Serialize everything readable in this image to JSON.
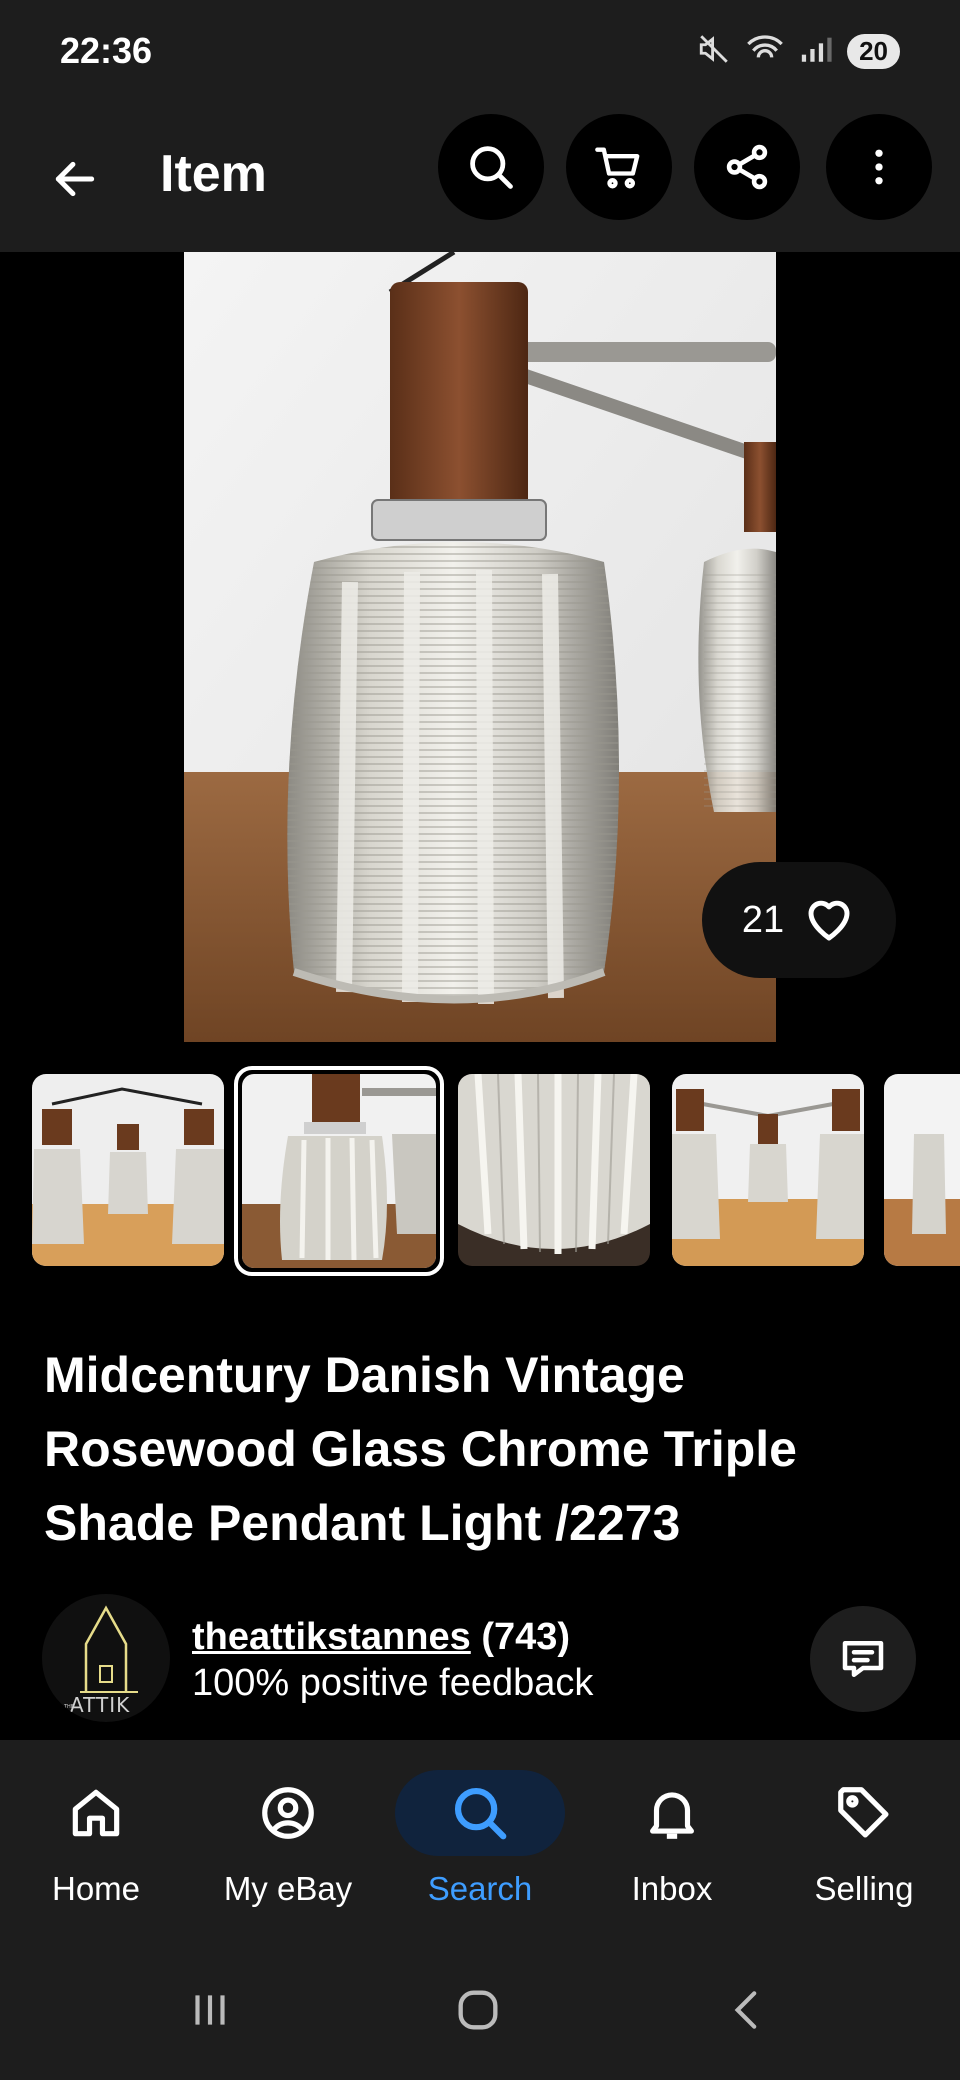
{
  "status_bar": {
    "time": "22:36",
    "battery": "20",
    "icons": [
      "mute-icon",
      "wifi-icon",
      "signal-icon"
    ]
  },
  "app_bar": {
    "title": "Item",
    "actions": [
      "search-icon",
      "cart-icon",
      "share-icon",
      "more-vertical-icon"
    ]
  },
  "hero": {
    "watch_count": "21"
  },
  "thumbnails": {
    "count_visible": 5,
    "selected_index": 1
  },
  "item": {
    "title_line1": "Midcentury Danish Vintage",
    "title_line2": "Rosewood Glass Chrome Triple",
    "title_line3": "Shade Pendant Light /2273"
  },
  "seller": {
    "name": "theattikstannes",
    "score": "(743)",
    "feedback": "100% positive feedback",
    "avatar_text": "ATTIK",
    "avatar_prefix": "THE"
  },
  "bottom_nav": {
    "items": [
      {
        "label": "Home",
        "icon": "home-icon"
      },
      {
        "label": "My eBay",
        "icon": "user-icon"
      },
      {
        "label": "Search",
        "icon": "search-icon"
      },
      {
        "label": "Inbox",
        "icon": "bell-icon"
      },
      {
        "label": "Selling",
        "icon": "tag-icon"
      }
    ],
    "active_index": 2
  },
  "colors": {
    "background": "#000000",
    "bar": "#1d1d1d",
    "accent": "#3e9dff",
    "active_pill": "#10233d"
  }
}
